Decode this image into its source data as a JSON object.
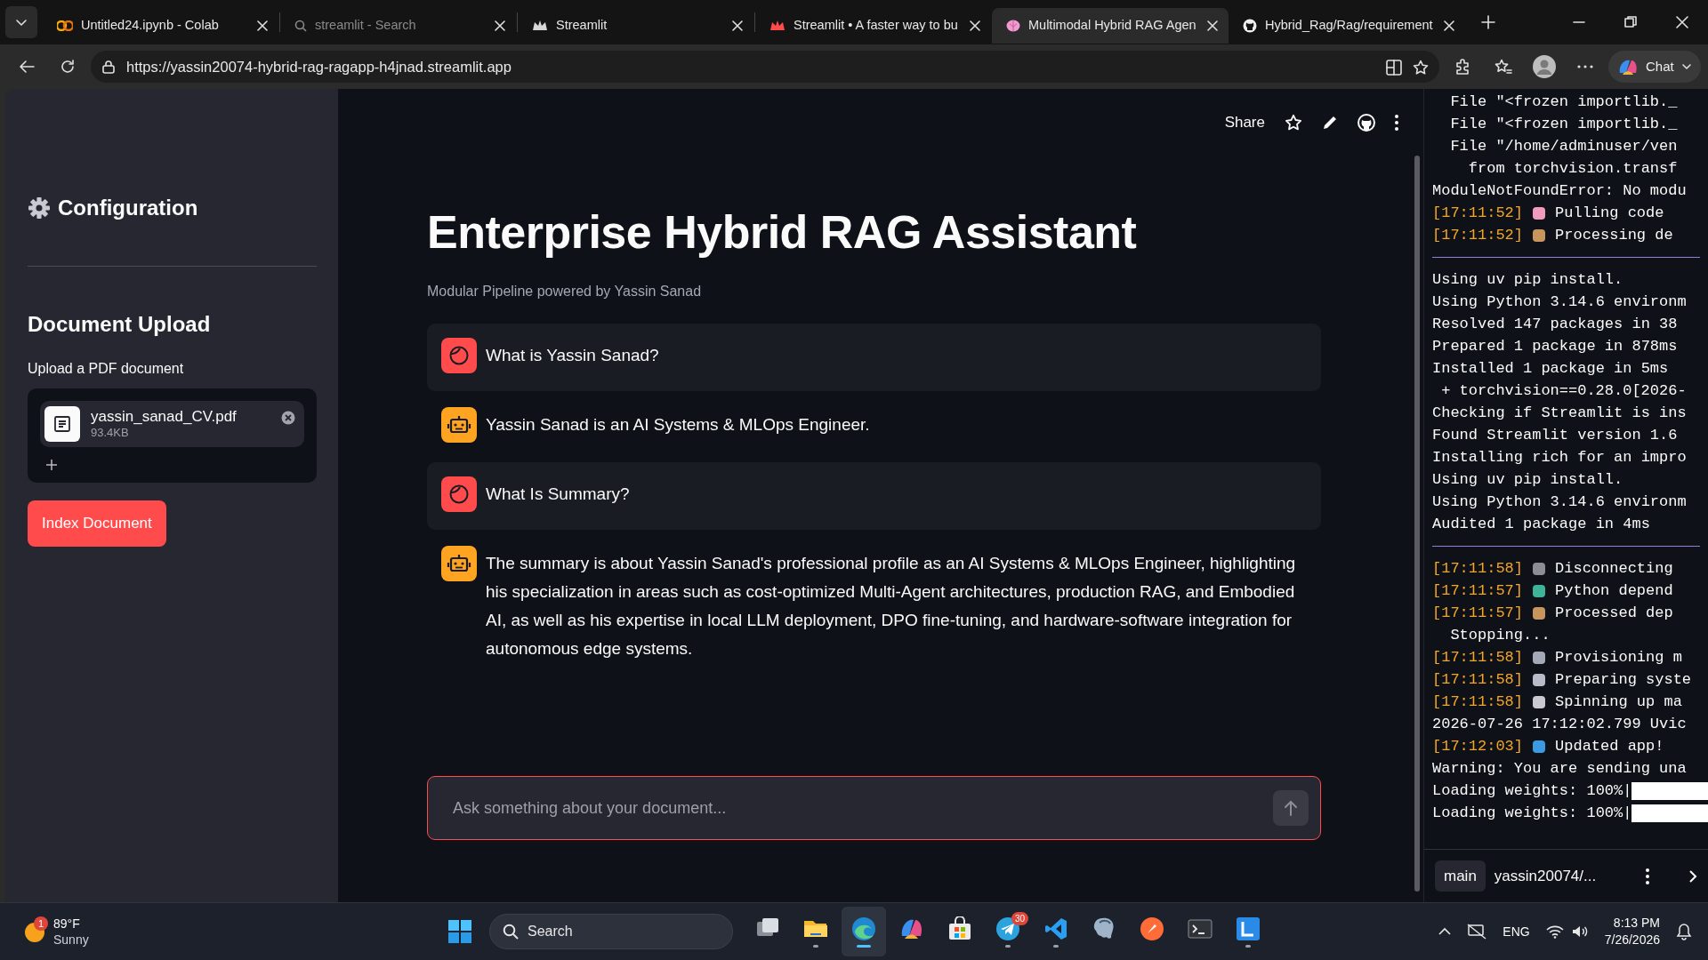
{
  "browser": {
    "tabs": [
      {
        "kind": "colab",
        "title": "Untitled24.ipynb - Colab",
        "selected": false,
        "sleeping": false
      },
      {
        "kind": "search",
        "title": "streamlit - Search",
        "selected": false,
        "sleeping": true
      },
      {
        "kind": "crown",
        "title": "Streamlit",
        "selected": false,
        "sleeping": false
      },
      {
        "kind": "crown-red",
        "title": "Streamlit • A faster way to bu",
        "selected": false,
        "sleeping": false
      },
      {
        "kind": "brain",
        "title": "Multimodal Hybrid RAG Agen",
        "selected": true,
        "sleeping": false
      },
      {
        "kind": "cat",
        "title": "Hybrid_Rag/Rag/requirement",
        "selected": false,
        "sleeping": false
      }
    ],
    "url": "https://yassin20074-hybrid-rag-ragapp-h4jnad.streamlit.app",
    "chat_button": "Chat"
  },
  "app": {
    "share": "Share",
    "sidebar": {
      "title": "Configuration",
      "section": "Document Upload",
      "upload_label": "Upload a PDF document",
      "file": {
        "name": "yassin_sanad_CV.pdf",
        "size": "93.4KB"
      },
      "button": "Index Document"
    },
    "title": "Enterprise Hybrid RAG Assistant",
    "caption": "Modular Pipeline powered by Yassin Sanad",
    "messages": [
      {
        "kind": "user",
        "text": "What is Yassin Sanad?"
      },
      {
        "kind": "assistant",
        "text": "Yassin Sanad is an AI Systems & MLOps Engineer."
      },
      {
        "kind": "user",
        "text": "What Is Summary?"
      },
      {
        "kind": "assistant",
        "text": "The summary is about Yassin Sanad's professional profile as an AI Systems & MLOps Engineer, highlighting his specialization in areas such as cost-optimized Multi-Agent architectures, production RAG, and Embodied AI, as well as his expertise in local LLM deployment, DPO fine-tuning, and hardware-software integration for autonomous edge systems."
      }
    ],
    "chat_input": {
      "placeholder": "Ask something about your document..."
    }
  },
  "console": {
    "lines": [
      {
        "kind": "indent",
        "text": "File \"<frozen importlib._"
      },
      {
        "kind": "indent",
        "text": "File \"<frozen importlib._"
      },
      {
        "kind": "indent",
        "text": "File \"/home/adminuser/ven"
      },
      {
        "kind": "deep",
        "text": "from torchvision.transf"
      },
      {
        "kind": "text",
        "text": "ModuleNotFoundError: No modu"
      },
      {
        "kind": "timed",
        "time": "[17:11:52]",
        "color": "#f29bbd",
        "text": "Pulling code"
      },
      {
        "kind": "timed",
        "time": "[17:11:52]",
        "color": "#c8955c",
        "text": "Processing de"
      },
      {
        "kind": "rule"
      },
      {
        "kind": "text",
        "text": "Using uv pip install."
      },
      {
        "kind": "text",
        "text": "Using Python 3.14.6 environm"
      },
      {
        "kind": "text",
        "text": "Resolved 147 packages in 38"
      },
      {
        "kind": "text",
        "text": "Prepared 1 package in 878ms"
      },
      {
        "kind": "text",
        "text": "Installed 1 package in 5ms"
      },
      {
        "kind": "nudge",
        "text": "+ torchvision==0.28.0[2026-"
      },
      {
        "kind": "text",
        "text": "Checking if Streamlit is ins"
      },
      {
        "kind": "text",
        "text": "Found Streamlit version 1.6"
      },
      {
        "kind": "text",
        "text": "Installing rich for an impro"
      },
      {
        "kind": "text",
        "text": "Using uv pip install."
      },
      {
        "kind": "text",
        "text": "Using Python 3.14.6 environm"
      },
      {
        "kind": "text",
        "text": "Audited 1 package in 4ms"
      },
      {
        "kind": "rule"
      },
      {
        "kind": "timed",
        "time": "[17:11:58]",
        "color": "#8d8d95",
        "text": "Disconnecting"
      },
      {
        "kind": "timed",
        "time": "[17:11:57]",
        "color": "#3fb39a",
        "text": "Python depend"
      },
      {
        "kind": "timed",
        "time": "[17:11:57]",
        "color": "#c8955c",
        "text": "Processed dep"
      },
      {
        "kind": "indent",
        "text": "Stopping..."
      },
      {
        "kind": "timed",
        "time": "[17:11:58]",
        "color": "#a4a9b8",
        "text": "Provisioning m"
      },
      {
        "kind": "timed",
        "time": "[17:11:58]",
        "color": "#b9bcc8",
        "text": "Preparing syste"
      },
      {
        "kind": "timed",
        "time": "[17:11:58]",
        "color": "#c9c9cf",
        "text": "Spinning up ma"
      },
      {
        "kind": "text",
        "text": "2026-07-26 17:12:02.799 Uvic"
      },
      {
        "kind": "timed",
        "time": "[17:12:03]",
        "color": "#3b9ae1",
        "text": "Updated app!"
      },
      {
        "kind": "text",
        "text": "Warning: You are sending una"
      },
      {
        "kind": "progress",
        "text": "Loading weights: 100%|",
        "level": 1
      },
      {
        "kind": "progress",
        "text": "Loading weights: 100%|",
        "level": 1
      }
    ],
    "branch": "main",
    "repo": "yassin20074/..."
  },
  "taskbar": {
    "weather": {
      "badge": "1",
      "temp": "89°F",
      "condition": "Sunny"
    },
    "search": "Search",
    "apps": [
      {
        "kind": "taskview",
        "running": false,
        "selected": false
      },
      {
        "kind": "folder",
        "running": true,
        "selected": false
      },
      {
        "kind": "browser",
        "running": true,
        "selected": true
      },
      {
        "kind": "ribbon",
        "running": false,
        "selected": false
      },
      {
        "kind": "store",
        "running": false,
        "selected": false
      },
      {
        "kind": "plane",
        "running": true,
        "selected": false,
        "badge": "30"
      },
      {
        "kind": "code",
        "running": true,
        "selected": false
      },
      {
        "kind": "elephant",
        "running": false,
        "selected": false
      },
      {
        "kind": "rocket",
        "running": false,
        "selected": false
      },
      {
        "kind": "terminal",
        "running": false,
        "selected": false
      },
      {
        "kind": "lens",
        "running": true,
        "selected": false
      }
    ],
    "lang": "ENG",
    "time": "8:13 PM",
    "date": "7/26/2026"
  }
}
